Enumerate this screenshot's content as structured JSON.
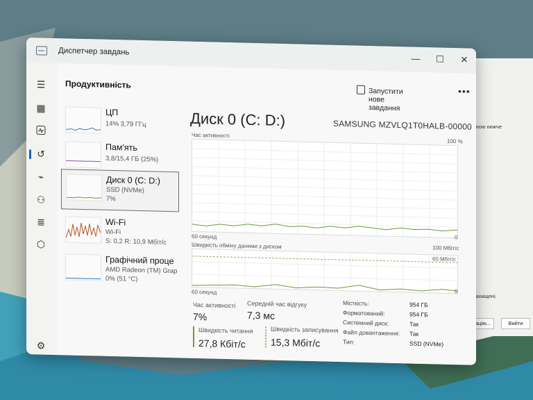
{
  "window": {
    "title": "Диспетчер завдань",
    "minimize": "—",
    "maximize": "☐",
    "close": "✕"
  },
  "header": {
    "page_title": "Продуктивність",
    "new_task_label": "Запустити нове завдання",
    "more_label": "•••"
  },
  "perf_list": [
    {
      "name": "ЦП",
      "line1": "14% 3,79 ГГц",
      "line2": ""
    },
    {
      "name": "Пам'ять",
      "line1": "3,8/15,4 ГБ (25%)",
      "line2": ""
    },
    {
      "name": "Диск 0 (C: D:)",
      "line1": "SSD (NVMe)",
      "line2": "7%"
    },
    {
      "name": "Wi-Fi",
      "line1": "Wi-Fi",
      "line2": "S: 0,2 R: 10,9 Мбіт/с"
    },
    {
      "name": "Графічний проце",
      "line1": "AMD Radeon (TM) Grap",
      "line2": "0% (51 °C)"
    }
  ],
  "main": {
    "title": "Диск 0 (C: D:)",
    "model": "SAMSUNG MZVLQ1T0HALB-00000",
    "graph1": {
      "label": "Час активності",
      "max": "100 %",
      "time": "60 секунд",
      "min": "0"
    },
    "graph2": {
      "label": "Швидкість обміну даними з диском",
      "max_top": "100 Мбіт/с",
      "max": "60 Мбіт/с",
      "time": "60 секунд",
      "min": "0"
    }
  },
  "stats": {
    "active_time_label": "Час активності",
    "active_time_value": "7%",
    "avg_response_label": "Середній час відгуку",
    "avg_response_value": "7,3 мс",
    "read_speed_label": "Швидкість читання",
    "read_speed_value": "27,8 Кбіт/с",
    "write_speed_label": "Швидкість записування",
    "write_speed_value": "15,3 Мбіт/с"
  },
  "details": [
    {
      "key": "Місткість:",
      "value": "954 ГБ"
    },
    {
      "key": "Форматований:",
      "value": "954 ГБ"
    },
    {
      "key": "Системний диск:",
      "value": "Так"
    },
    {
      "key": "Файл довантаження:",
      "value": "Так"
    },
    {
      "key": "Тип:",
      "value": "SSD (NVMe)"
    }
  ],
  "background_window": {
    "text1": "юною нижче",
    "text2": "захищені.",
    "button1": "єнацію...",
    "button2": "Вийти"
  },
  "colors": {
    "disk_graph": "#6a9a3a",
    "wifi_graph": "#b2552a",
    "cpu_graph": "#2f7bbf",
    "mem_graph": "#8a4fb8",
    "read_bar": "#6a9a3a",
    "write_bar": "#8bb36a"
  }
}
